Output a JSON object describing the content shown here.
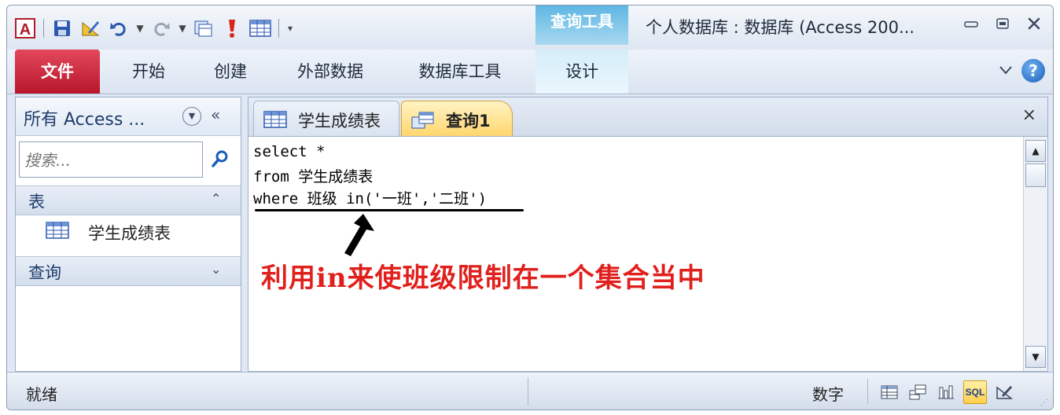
{
  "window": {
    "title": "个人数据库 : 数据库 (Access 200...",
    "context_tab_header": "查询工具"
  },
  "ribbon": {
    "tabs": [
      {
        "label": "文件"
      },
      {
        "label": "开始"
      },
      {
        "label": "创建"
      },
      {
        "label": "外部数据"
      },
      {
        "label": "数据库工具"
      },
      {
        "label": "设计"
      }
    ],
    "help_label": "?"
  },
  "nav_pane": {
    "title": "所有 Access ...",
    "collapse_label": "«",
    "search_placeholder": "搜索...",
    "groups": [
      {
        "label": "表",
        "toggle": "⌃",
        "items": [
          {
            "label": "学生成绩表"
          }
        ]
      },
      {
        "label": "查询",
        "toggle": "⌄"
      }
    ]
  },
  "documents": {
    "tabs": [
      {
        "label": "学生成绩表"
      },
      {
        "label": "查询1"
      }
    ],
    "close_label": "×"
  },
  "sql_editor": {
    "lines": [
      "select *",
      "from 学生成绩表",
      "where 班级 in('一班','二班')"
    ],
    "annotation": "利用in来使班级限制在一个集合当中"
  },
  "statusbar": {
    "status": "就绪",
    "mode": "数字",
    "view_sql_label": "SQL"
  },
  "colors": {
    "file_tab": "#c8203a",
    "context_tab": "#5fb6e3",
    "annotation": "#e0201c",
    "active_view": "#ffcf4a"
  }
}
